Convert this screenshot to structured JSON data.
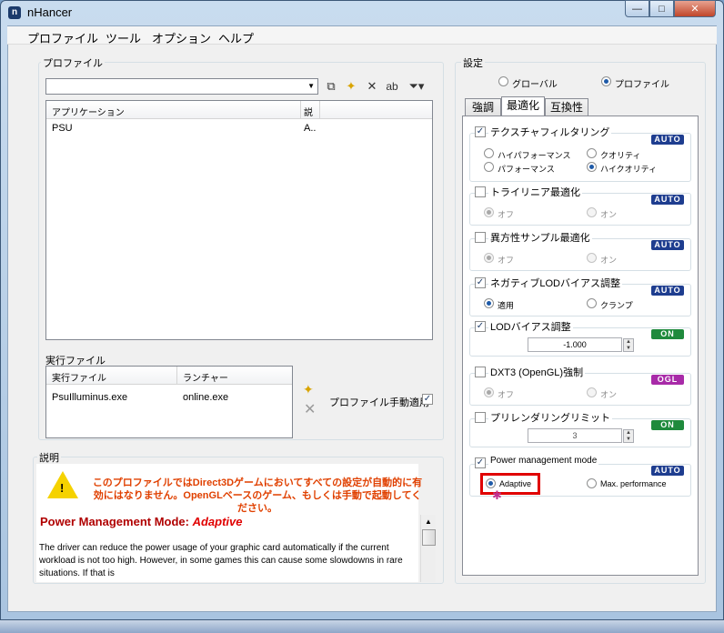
{
  "window": {
    "title": "nHancer",
    "min": "—",
    "max": "□",
    "close": "✕"
  },
  "menu": [
    "プロファイル",
    "ツール",
    "オプション",
    "ヘルプ"
  ],
  "profile": {
    "group_label": "プロファイル",
    "search_value": "",
    "columns": [
      "アプリケーション",
      "説"
    ],
    "rows": [
      {
        "app": "PSU",
        "desc": "A.."
      }
    ]
  },
  "exec": {
    "group_label": "実行ファイル",
    "columns": [
      "実行ファイル",
      "ランチャー"
    ],
    "rows": [
      {
        "file": "PsuIlluminus.exe",
        "launcher": "online.exe"
      }
    ],
    "manual_apply_label": "プロファイル手動適用"
  },
  "description": {
    "group_label": "説明",
    "warning": "このプロファイルではDirect3Dゲームにおいてすべての設定が自動的に有効にはなりません。OpenGLベースのゲーム、もしくは手動で起動してください。",
    "heading_prefix": "Power Management Mode: ",
    "heading_value": "Adaptive",
    "body": "The driver can reduce the power usage of your graphic card automatically if the current workload is not too high. However, in some games this can cause some slowdowns in rare situations. If that is"
  },
  "settings": {
    "group_label": "設定",
    "scope_global": "グローバル",
    "scope_profile": "プロファイル",
    "tabs": [
      "強調",
      "最適化",
      "互換性"
    ],
    "badges": {
      "auto": "AUTO",
      "on": "ON",
      "ogl": "OGL"
    },
    "texture": {
      "label": "テクスチャフィルタリング",
      "opts": [
        "ハイパフォーマンス",
        "クオリティ",
        "パフォーマンス",
        "ハイクオリティ"
      ]
    },
    "trilinear": {
      "label": "トライリニア最適化",
      "off": "オフ",
      "on": "オン"
    },
    "aniso": {
      "label": "異方性サンプル最適化",
      "off": "オフ",
      "on": "オン"
    },
    "neglod": {
      "label": "ネガティブLODバイアス調整",
      "apply": "適用",
      "clamp": "クランプ"
    },
    "lodbias": {
      "label": "LODバイアス調整",
      "value": "-1.000"
    },
    "dxt3": {
      "label": "DXT3 (OpenGL)強制",
      "off": "オフ",
      "on": "オン"
    },
    "prerender": {
      "label": "プリレンダリングリミット",
      "value": "3"
    },
    "power": {
      "label": "Power management mode",
      "adaptive": "Adaptive",
      "maxperf": "Max. performance"
    }
  },
  "colors": {
    "auto": "#1e3d8f",
    "on": "#1f8a3c",
    "ogl": "#a82aa8",
    "warning": "#e04000",
    "heading": "#b00000",
    "highlight": "#e00000"
  }
}
